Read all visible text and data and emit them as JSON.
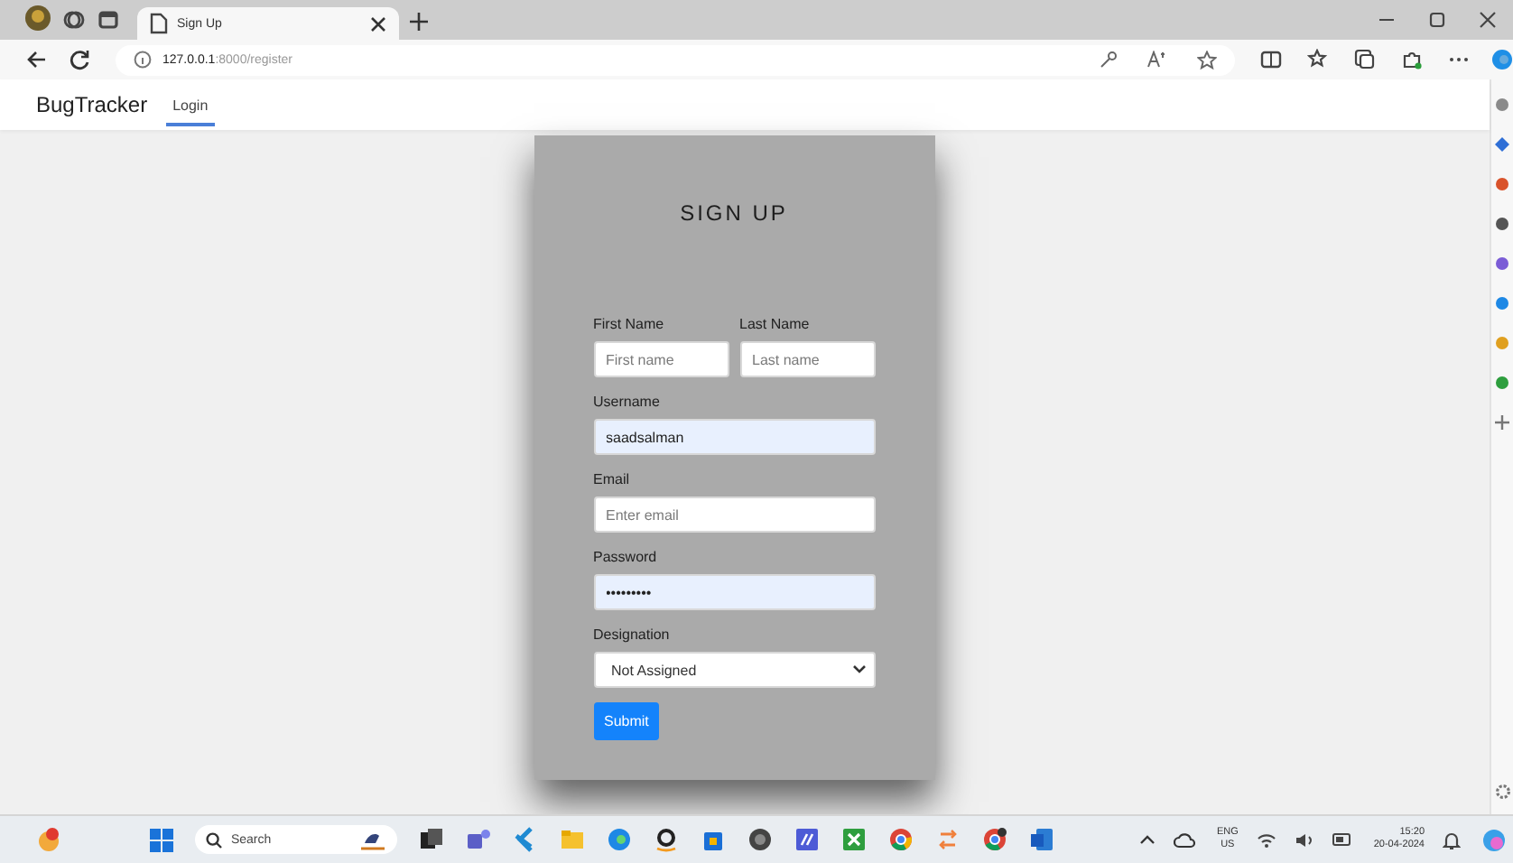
{
  "browser": {
    "tabs": [
      {
        "title": "Sign Up",
        "selected": true
      }
    ],
    "address": {
      "host": "127.0.0.1",
      "path": ":8000/register"
    }
  },
  "navbar": {
    "brand": "BugTracker",
    "links": [
      {
        "label": "Login",
        "selected": true
      }
    ]
  },
  "form": {
    "title": "SIGN UP",
    "rows": [
      [
        {
          "kind": "text",
          "label": "First Name",
          "placeholder": "First name",
          "autofilled": false
        },
        {
          "kind": "text",
          "label": "Last Name",
          "placeholder": "Last name",
          "autofilled": false
        }
      ],
      [
        {
          "kind": "text",
          "label": "Username",
          "value": "saadsalman",
          "autofilled": true
        }
      ],
      [
        {
          "kind": "text",
          "label": "Email",
          "placeholder": "Enter email",
          "autofilled": false
        }
      ],
      [
        {
          "kind": "text",
          "label": "Password",
          "value": "•••••••••",
          "autofilled": true
        }
      ],
      [
        {
          "kind": "select",
          "label": "Designation",
          "value": "Not Assigned",
          "autofilled": false
        }
      ]
    ],
    "submit": "Submit"
  },
  "taskbar": {
    "search": {
      "placeholder": "Search"
    },
    "language": "ENG",
    "region": "US",
    "time": "15:20",
    "date": "20-04-2024"
  }
}
